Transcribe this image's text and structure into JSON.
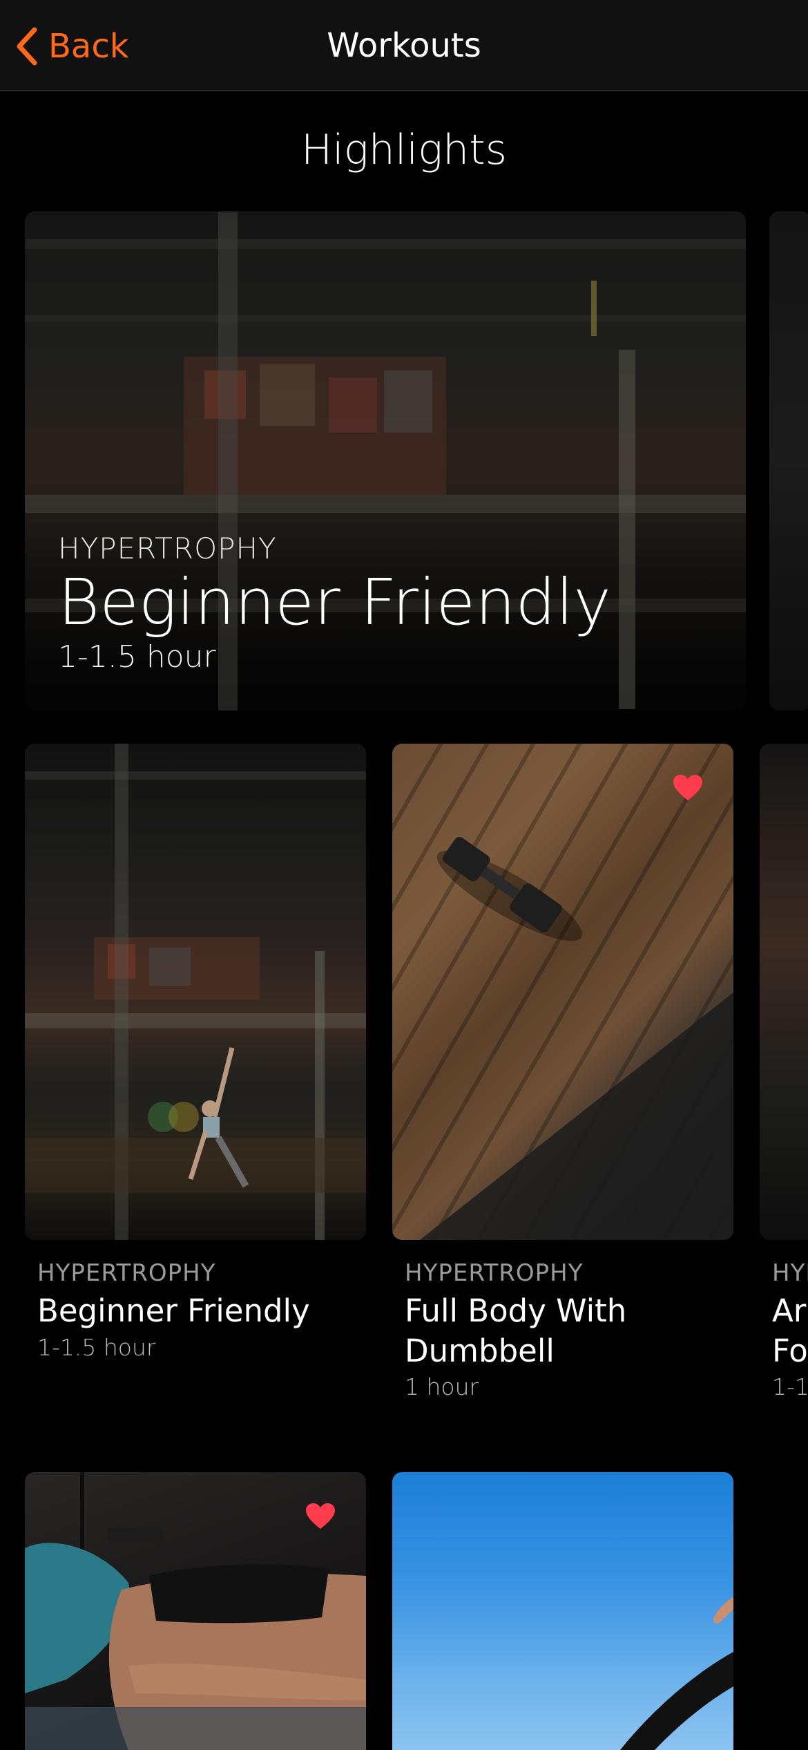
{
  "nav": {
    "back_label": "Back",
    "title": "Workouts"
  },
  "section": {
    "title": "Highlights"
  },
  "hero": {
    "category": "HYPERTROPHY",
    "name": "Beginner Friendly",
    "duration": "1-1.5 hour"
  },
  "workouts": [
    {
      "category": "HYPERTROPHY",
      "name": "Beginner Friendly",
      "duration": "1-1.5 hour",
      "favorite": false
    },
    {
      "category": "HYPERTROPHY",
      "name": "Full Body With Dumbbell",
      "duration": "1 hour",
      "favorite": true
    },
    {
      "category_partial": "HYI",
      "name_partial_1": "Ar",
      "name_partial_2": "Fo",
      "duration_partial": "1-1"
    }
  ],
  "row2": [
    {
      "favorite": true
    },
    {
      "favorite": false
    }
  ],
  "colors": {
    "accent": "#ff6a1a",
    "heart": "#ff3b4e",
    "background": "#000000",
    "navbar": "#111111"
  }
}
